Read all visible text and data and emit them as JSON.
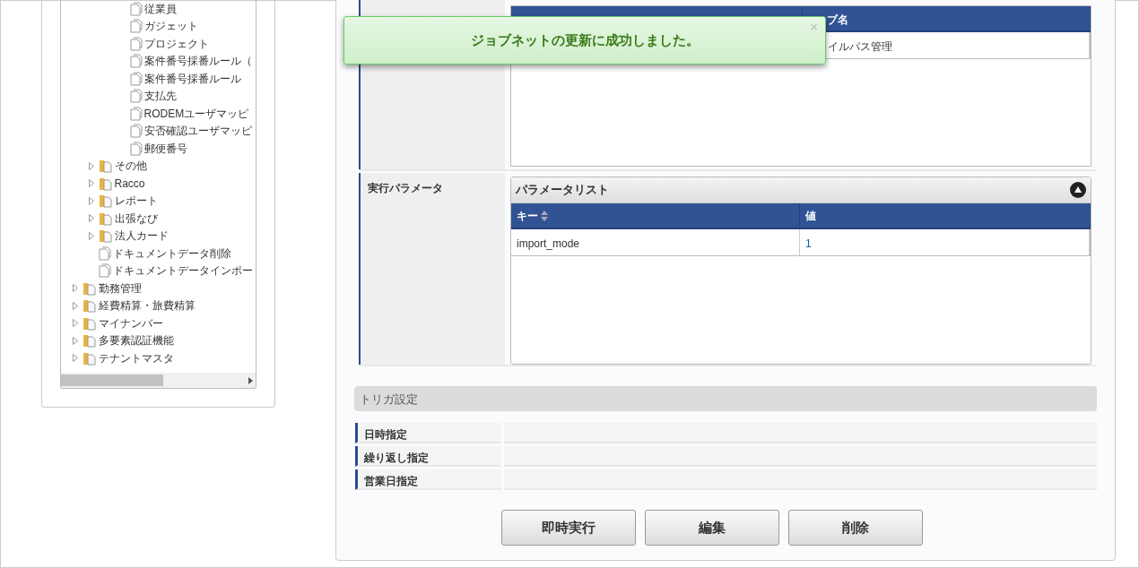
{
  "tree": {
    "items": [
      {
        "children": [
          {
            "children": [
              {
                "children": [
                  {
                    "kind": "file",
                    "label": "従業員"
                  },
                  {
                    "kind": "file",
                    "label": "ガジェット"
                  },
                  {
                    "kind": "file",
                    "label": "プロジェクト"
                  },
                  {
                    "kind": "file",
                    "label": "案件番号採番ルール（"
                  },
                  {
                    "kind": "file",
                    "label": "案件番号採番ルール"
                  },
                  {
                    "kind": "file",
                    "label": "支払先"
                  },
                  {
                    "kind": "file",
                    "label": "RODEMユーザマッピ"
                  },
                  {
                    "kind": "file",
                    "label": "安否確認ユーザマッピ"
                  },
                  {
                    "kind": "file",
                    "label": "郵便番号"
                  }
                ]
              }
            ]
          },
          {
            "kind": "folder",
            "label": "その他",
            "expanded": false
          },
          {
            "kind": "folder",
            "label": "Racco",
            "expanded": false
          },
          {
            "kind": "folder",
            "label": "レポート",
            "expanded": false
          },
          {
            "kind": "folder",
            "label": "出張なび",
            "expanded": false
          },
          {
            "kind": "folder",
            "label": "法人カード",
            "expanded": false
          },
          {
            "kind": "file",
            "label": "ドキュメントデータ削除"
          },
          {
            "kind": "file",
            "label": "ドキュメントデータインポー"
          }
        ]
      },
      {
        "kind": "folder",
        "label": "勤務管理",
        "expanded": false
      },
      {
        "kind": "folder",
        "label": "経費精算・旅費精算",
        "expanded": false
      },
      {
        "kind": "folder",
        "label": "マイナンバー",
        "expanded": false
      },
      {
        "kind": "folder",
        "label": "多要素認証機能",
        "expanded": false
      },
      {
        "kind": "folder",
        "label": "テナントマスタ",
        "expanded": false
      }
    ]
  },
  "job_table": {
    "column_2_header": "ブ名",
    "rows": [
      {
        "column_2": "イルパス管理"
      }
    ]
  },
  "params": {
    "label": "実行パラメータ",
    "panel_title": "パラメータリスト",
    "expanded": true,
    "columns": [
      {
        "label": "キー",
        "sortable": true
      },
      {
        "label": "値",
        "sortable": false
      }
    ],
    "rows": [
      [
        "import_mode",
        "1"
      ]
    ]
  },
  "trigger": {
    "title": "トリガ設定",
    "rows": [
      {
        "label": "日時指定"
      },
      {
        "label": "繰り返し指定"
      },
      {
        "label": "営業日指定"
      }
    ]
  },
  "buttons": [
    {
      "label": "即時実行"
    },
    {
      "label": "編集"
    },
    {
      "label": "削除"
    }
  ],
  "toast": {
    "message": "ジョブネットの更新に成功しました。",
    "close": "×"
  }
}
